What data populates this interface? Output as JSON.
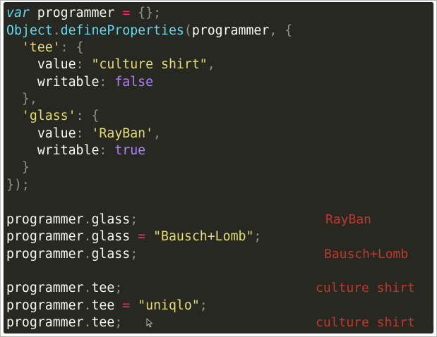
{
  "code": {
    "l1": {
      "kw": "var",
      "name": " programmer ",
      "op": "=",
      "rest": " {};"
    },
    "l2": {
      "obj": "Object",
      "dot": ".",
      "method": "defineProperties",
      "open": "(",
      "arg": "programmer",
      "comma": ", ",
      "brace": "{"
    },
    "l3": {
      "indent": "  ",
      "q1": "'",
      "key": "tee",
      "q2": "'",
      "colon": ": ",
      "brace": "{"
    },
    "l4": {
      "indent": "    ",
      "prop": "value",
      "colon": ": ",
      "q1": "\"",
      "str": "culture shirt",
      "q2": "\"",
      "comma": ","
    },
    "l5": {
      "indent": "    ",
      "prop": "writable",
      "colon": ": ",
      "val": "false"
    },
    "l6": {
      "indent": "  ",
      "text": "},"
    },
    "l7": {
      "indent": "  ",
      "q1": "'",
      "key": "glass",
      "q2": "'",
      "colon": ": ",
      "brace": "{"
    },
    "l8": {
      "indent": "    ",
      "prop": "value",
      "colon": ": ",
      "q1": "'",
      "str": "RayBan",
      "q2": "'",
      "comma": ","
    },
    "l9": {
      "indent": "    ",
      "prop": "writable",
      "colon": ": ",
      "val": "true"
    },
    "l10": {
      "indent": "  ",
      "text": "}"
    },
    "l11": {
      "text": "});"
    },
    "l12": {
      "obj": "programmer",
      "dot": ".",
      "prop": "glass",
      "semi": ";"
    },
    "l13": {
      "obj": "programmer",
      "dot": ".",
      "prop": "glass",
      "op": " = ",
      "q1": "\"",
      "str": "Bausch+Lomb",
      "q2": "\"",
      "semi": ";"
    },
    "l14": {
      "obj": "programmer",
      "dot": ".",
      "prop": "glass",
      "semi": ";"
    },
    "l15": {
      "obj": "programmer",
      "dot": ".",
      "prop": "tee",
      "semi": ";"
    },
    "l16": {
      "obj": "programmer",
      "dot": ".",
      "prop": "tee",
      "op": " = ",
      "q1": "\"",
      "str": "uniqlo",
      "q2": "\"",
      "semi": ";"
    },
    "l17": {
      "obj": "programmer",
      "dot": ".",
      "prop": "tee",
      "semi": ";"
    }
  },
  "outputs": {
    "glass1": "RayBan",
    "glass2": "Bausch+Lomb",
    "tee1": "culture shirt",
    "tee2": "culture shirt"
  },
  "icons": {
    "cursor": "mouse-pointer-icon"
  },
  "colors": {
    "background": "#272822",
    "text": "#f8f8f2",
    "keyword": "#66d9ef",
    "operator": "#f92672",
    "string": "#e6db74",
    "boolean": "#ae81ff",
    "punctuation": "#8f908a",
    "output": "#c0392b"
  }
}
